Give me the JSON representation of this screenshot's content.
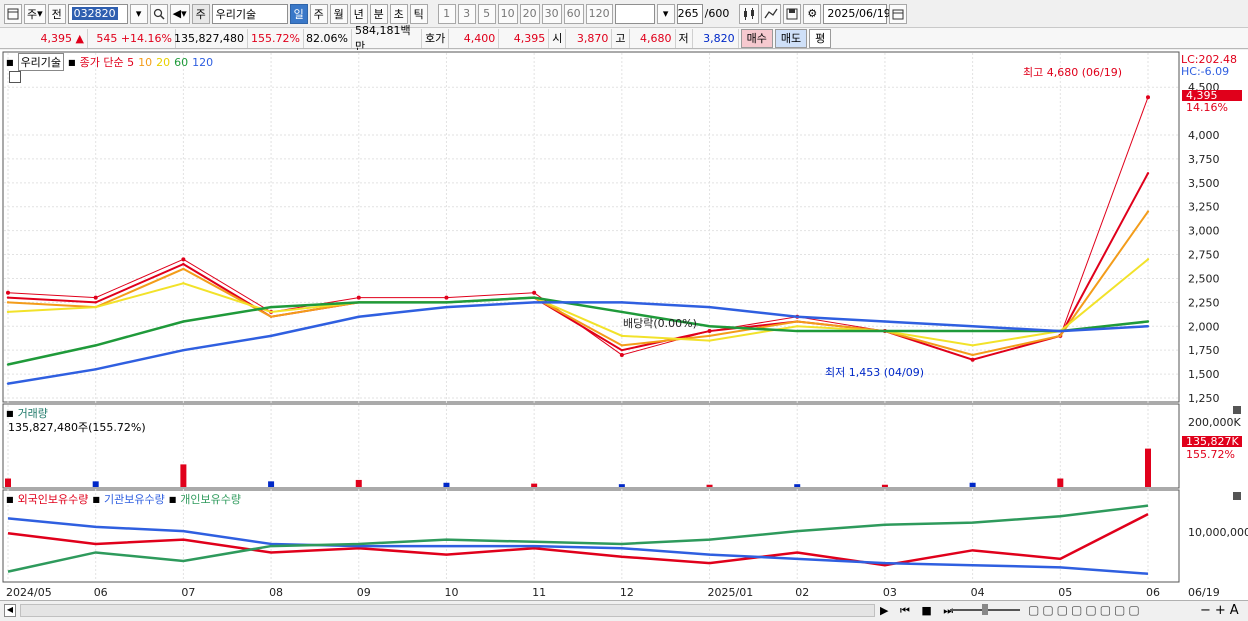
{
  "toolbar": {
    "period_label": "주",
    "prev_label": "전",
    "code": "032820",
    "stock_tag": "주",
    "stock_name": "우리기술",
    "periods": [
      "일",
      "주",
      "월",
      "년",
      "분",
      "초",
      "틱"
    ],
    "active_period": "일",
    "intervals": [
      "1",
      "3",
      "5",
      "10",
      "20",
      "30",
      "60",
      "120"
    ],
    "count": "265",
    "count_total": "/600",
    "date": "2025/06/19"
  },
  "quote": {
    "price": "4,395",
    "arrow": "▲",
    "change": "545",
    "change_pct": "+14.16%",
    "volume": "135,827,480",
    "volume_ratio": "155.72%",
    "turnover": "82.06%",
    "amount": "584,181백만",
    "ask_label": "호가",
    "ask": "4,400",
    "bid": "4,395",
    "open_label": "시",
    "open": "3,870",
    "high_label": "고",
    "high": "4,680",
    "low_label": "저",
    "low": "3,820",
    "buy_label": "매수",
    "sell_label": "매도",
    "eval_label": "평"
  },
  "price_pane": {
    "stock_name": "우리기술",
    "ma_label": "종가 단순 5",
    "ma_periods": [
      "10",
      "20",
      "60",
      "120"
    ],
    "lc_label": "LC:202.48",
    "hc_label": "HC:-6.09",
    "y_ticks": [
      "4,500",
      "4,000",
      "3,750",
      "3,500",
      "3,250",
      "3,000",
      "2,750",
      "2,500",
      "2,250",
      "2,000",
      "1,750",
      "1,500",
      "1,250"
    ],
    "price_tag": "4,395",
    "pct_tag": "14.16%",
    "high_annotation": "최고 4,680 (06/19)",
    "low_annotation": "최저 1,453 (04/09)",
    "dividend_annotation": "배당락(0.00%)"
  },
  "volume_pane": {
    "title": "거래량",
    "value_text": "135,827,480주(155.72%)",
    "y_tick": "200,000K",
    "tag_value": "135,827K",
    "tag_pct": "155.72%"
  },
  "holdings_pane": {
    "series_labels": [
      "외국인보유수량",
      "기관보유수량",
      "개인보유수량"
    ],
    "y_tick": "10,000,000"
  },
  "x_axis": {
    "labels": [
      "2024/05",
      "06",
      "07",
      "08",
      "09",
      "10",
      "11",
      "12",
      "2025/01",
      "02",
      "03",
      "04",
      "05",
      "06"
    ],
    "right_label": "06/19"
  },
  "colors": {
    "up": "#e0001b",
    "down": "#0028c8",
    "ma5": "#e0001b",
    "ma10": "#f39c1a",
    "ma20": "#f2e22a",
    "ma60": "#1f9a3a",
    "ma120": "#2f5fe0",
    "foreign": "#e0001b",
    "institution": "#2f5fe0",
    "individual": "#2e9a5c"
  },
  "chart_data": [
    {
      "type": "line",
      "title": "우리기술",
      "x": [
        "2024/05",
        "2024/06",
        "2024/07",
        "2024/08",
        "2024/09",
        "2024/10",
        "2024/11",
        "2024/12",
        "2025/01",
        "2025/02",
        "2025/03",
        "2025/04",
        "2025/05",
        "2025/06"
      ],
      "series": [
        {
          "name": "종가",
          "values": [
            2350,
            2300,
            2700,
            2150,
            2300,
            2300,
            2350,
            1700,
            1950,
            2100,
            1950,
            1650,
            1900,
            4395
          ]
        },
        {
          "name": "5",
          "values": [
            2300,
            2250,
            2650,
            2100,
            2250,
            2250,
            2300,
            1750,
            1950,
            2050,
            1950,
            1650,
            1900,
            3600
          ]
        },
        {
          "name": "10",
          "values": [
            2250,
            2200,
            2600,
            2100,
            2250,
            2250,
            2300,
            1800,
            1900,
            2050,
            1950,
            1700,
            1900,
            3200
          ]
        },
        {
          "name": "20",
          "values": [
            2150,
            2200,
            2450,
            2150,
            2250,
            2250,
            2300,
            1900,
            1850,
            2000,
            1950,
            1800,
            1950,
            2700
          ]
        },
        {
          "name": "60",
          "values": [
            1600,
            1800,
            2050,
            2200,
            2250,
            2250,
            2300,
            2150,
            2000,
            1950,
            1950,
            1950,
            1950,
            2050
          ]
        },
        {
          "name": "120",
          "values": [
            1400,
            1550,
            1750,
            1900,
            2100,
            2200,
            2250,
            2250,
            2200,
            2100,
            2050,
            2000,
            1950,
            2000
          ]
        }
      ],
      "ylim": [
        1250,
        4680
      ],
      "annotations": [
        "최고 4,680 (06/19)",
        "최저 1,453 (04/09)",
        "배당락(0.00%)"
      ]
    },
    {
      "type": "bar",
      "title": "거래량",
      "categories": [
        "2024/05",
        "2024/06",
        "2024/07",
        "2024/08",
        "2024/09",
        "2024/10",
        "2024/11",
        "2024/12",
        "2025/01",
        "2025/02",
        "2025/03",
        "2025/04",
        "2025/05",
        "2025/06"
      ],
      "values": [
        30000,
        20000,
        80000,
        20000,
        25000,
        15000,
        12000,
        10000,
        8000,
        10000,
        8000,
        15000,
        30000,
        135827
      ],
      "ylim": [
        0,
        230000
      ]
    },
    {
      "type": "line",
      "categories": [
        "2024/05",
        "2024/06",
        "2024/07",
        "2024/08",
        "2024/09",
        "2024/10",
        "2024/11",
        "2024/12",
        "2025/01",
        "2025/02",
        "2025/03",
        "2025/04",
        "2025/05",
        "2025/06"
      ],
      "series": [
        {
          "name": "외국인보유수량",
          "values": [
            10500000,
            8000000,
            9000000,
            6000000,
            7000000,
            5500000,
            7000000,
            5000000,
            3500000,
            6000000,
            3000000,
            6500000,
            4500000,
            15000000
          ]
        },
        {
          "name": "기관보유수량",
          "values": [
            14000000,
            12000000,
            11000000,
            8000000,
            7500000,
            7500000,
            7500000,
            7000000,
            5500000,
            4500000,
            3500000,
            3000000,
            2500000,
            1000000
          ]
        },
        {
          "name": "개인보유수량",
          "values": [
            1500000,
            6000000,
            4000000,
            7500000,
            8000000,
            9000000,
            8500000,
            8000000,
            9000000,
            11000000,
            12500000,
            13000000,
            14500000,
            17000000
          ]
        }
      ]
    }
  ]
}
